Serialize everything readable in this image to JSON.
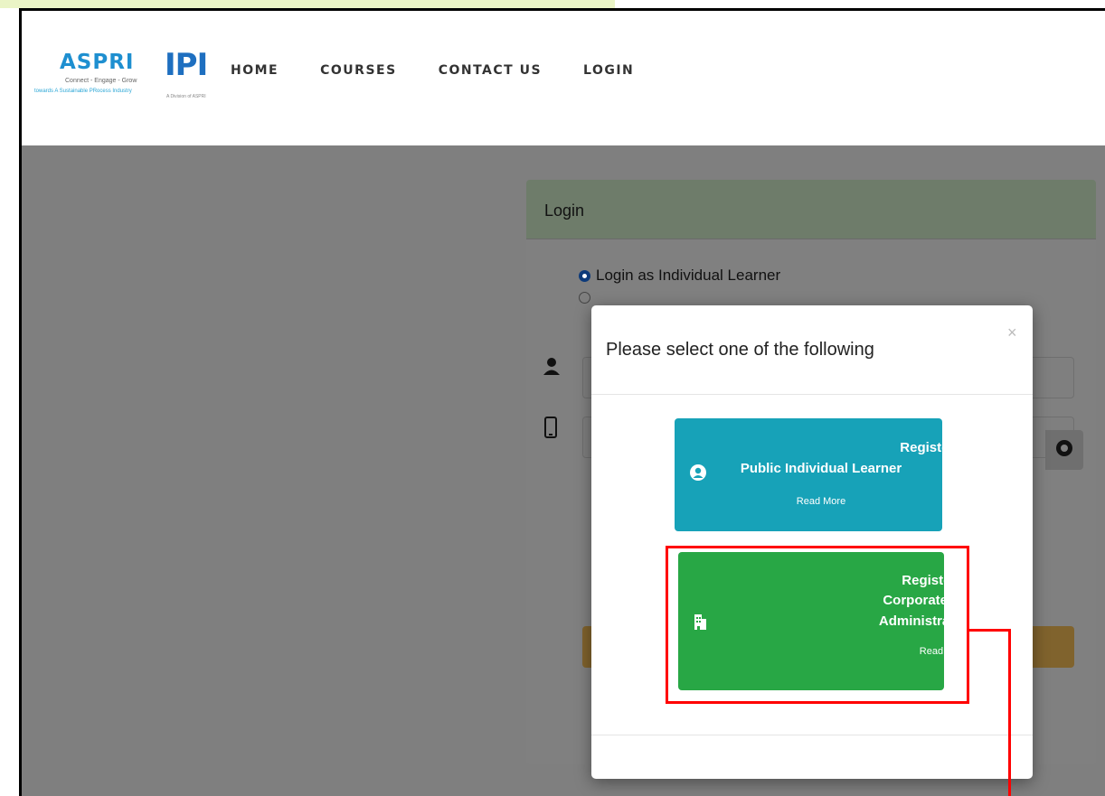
{
  "logos": {
    "aspri_word": "ASPRI",
    "aspri_tagline": "Connect - Engage - Grow",
    "aspri_sub": "towards A Sustainable PRocess Industry",
    "ipi_word": "IPI",
    "ipi_sub": "A Division of ASPRI"
  },
  "nav": {
    "items": [
      "HOME",
      "COURSES",
      "CONTACT US",
      "LOGIN"
    ]
  },
  "login_card": {
    "title": "Login",
    "radio_individual": "Login as Individual Learner"
  },
  "modal": {
    "title": "Please select one of the following",
    "close_glyph": "×",
    "public_option": {
      "line1": "Register as a",
      "line2": "Public Individual Learner",
      "read_more": "Read More"
    },
    "corporate_option": {
      "line1": "Register as a",
      "line2": "Corporate Account",
      "line3": "Administrator / User",
      "read_more": "Read More"
    }
  },
  "colors": {
    "public_button": "#17a2b8",
    "corporate_button": "#28a745",
    "highlight": "#ff0000",
    "overlay": "#7f7f7f"
  },
  "icons": {
    "user": "user-icon",
    "phone": "mobile-icon",
    "eye": "eye-icon",
    "user_circle": "user-circle-icon",
    "building": "building-icon"
  }
}
